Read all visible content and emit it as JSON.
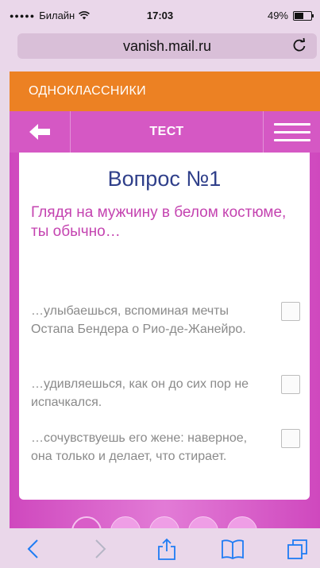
{
  "status": {
    "carrier": "Билайн",
    "time": "17:03",
    "battery": "49%",
    "battery_level": 0.49
  },
  "browser": {
    "url": "vanish.mail.ru"
  },
  "brand": {
    "label": "ОДНОКЛАССНИКИ"
  },
  "nav": {
    "title": "ТЕСТ"
  },
  "quiz": {
    "question_title": "Вопрос №1",
    "question_text": "Глядя на мужчину в белом костюме, ты обычно…",
    "answers": [
      {
        "label": "…улыбаешься, вспоминая мечты Остапа Бендера о Рио-де-Жанейро."
      },
      {
        "label": "…удивляешься, как он до сих пор не испачкался."
      },
      {
        "label": "…сочувствуешь его жене: наверное, она только и делает, что стирает."
      }
    ],
    "pages_count": 5,
    "active_page": 1
  },
  "colors": {
    "brand_orange": "#ec8123",
    "nav_pink": "#d558c4",
    "title_blue": "#2f3f8a",
    "question_pink": "#c443b0",
    "ios_blue": "#1f7cf4"
  }
}
